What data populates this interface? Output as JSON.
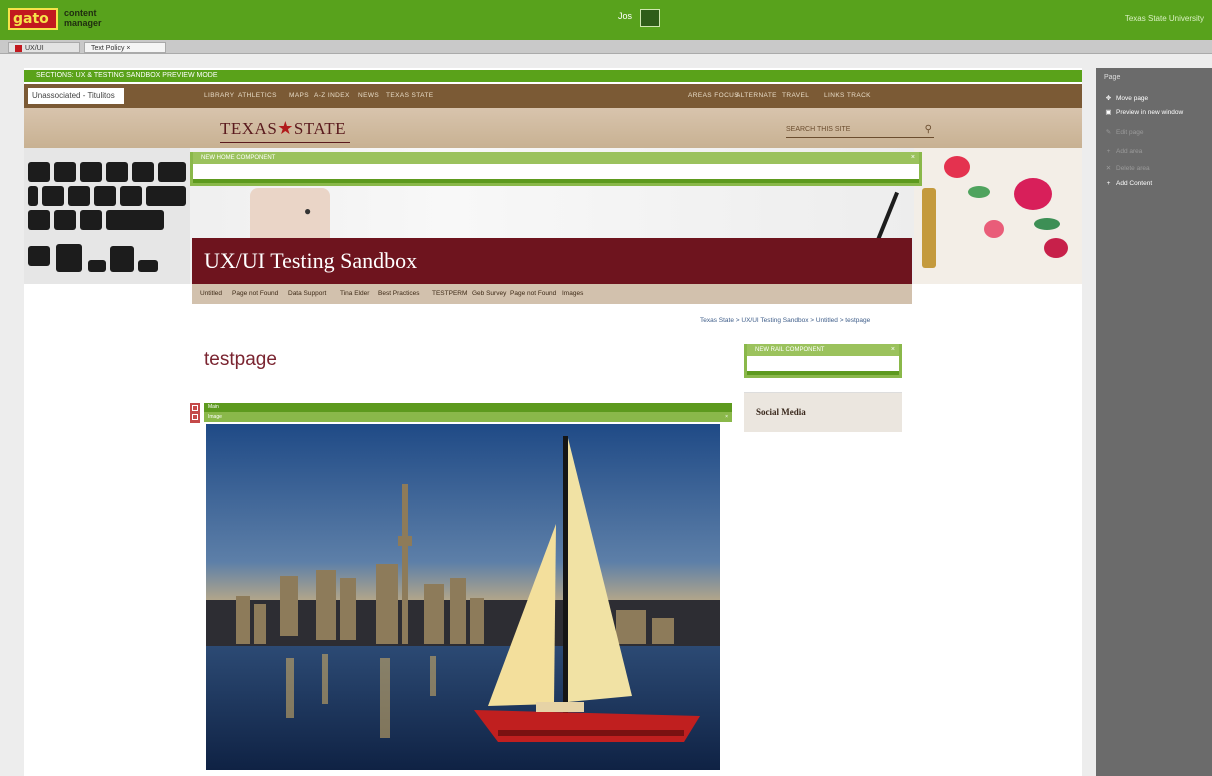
{
  "app": {
    "logo_text": "gato",
    "logo_tagline": "content manager",
    "center_label": "Jos",
    "right_text": "Texas State University"
  },
  "tabs": [
    {
      "label": "UX/UI"
    },
    {
      "label": "Text Policy"
    }
  ],
  "preview_bar": "SECTIONS: UX & TESTING SANDBOX PREVIEW MODE",
  "site": {
    "unit_label": "Unassociated - Titulitos",
    "nav": [
      "LIBRARY",
      "ATHLETICS",
      "MAPS",
      "A-Z INDEX",
      "NEWS",
      "TEXAS STATE",
      "AREAS FOCUS",
      "ALTERNATE",
      "TRAVEL",
      "LINKS TRACK"
    ],
    "brand_left": "TEXAS",
    "brand_star": "★",
    "brand_right": "STATE",
    "search_placeholder": "SEARCH THIS SITE",
    "search_icon": "search-icon",
    "edit_bar_label": "NEW HOME COMPONENT",
    "title": "UX/UI Testing Sandbox",
    "subnav": [
      "Untitled",
      "Page not Found",
      "Data Support",
      "Tina Elder",
      "Best Practices",
      "TESTPERM",
      "Geb Survey",
      "Page not Found",
      "Images"
    ],
    "breadcrumb": "Texas State > UX/UI Testing Sandbox > Untitled > testpage",
    "page_title": "testpage",
    "rail_edit_label": "NEW RAIL COMPONENT",
    "social_heading": "Social Media",
    "block_bar1": "Main",
    "block_bar2": "Image",
    "close_glyph": "×"
  },
  "panel": {
    "header": "Page",
    "items": [
      {
        "icon": "move-icon",
        "glyph": "✥",
        "label": "Move page",
        "enabled": true
      },
      {
        "icon": "preview-icon",
        "glyph": "▣",
        "label": "Preview in new window",
        "enabled": true
      },
      {
        "icon": "edit-icon",
        "glyph": "✎",
        "label": "Edit page",
        "enabled": false
      },
      {
        "icon": "add-icon",
        "glyph": "+",
        "label": "Add area",
        "enabled": false
      },
      {
        "icon": "delete-icon",
        "glyph": "✕",
        "label": "Delete area",
        "enabled": false
      },
      {
        "icon": "add-content-icon",
        "glyph": "+",
        "label": "Add Content",
        "enabled": true
      }
    ]
  },
  "colors": {
    "app_green": "#58a21c",
    "site_brown": "#7b5a35",
    "site_maroon": "#6e141e",
    "panel_gray": "#6b6b6b"
  }
}
